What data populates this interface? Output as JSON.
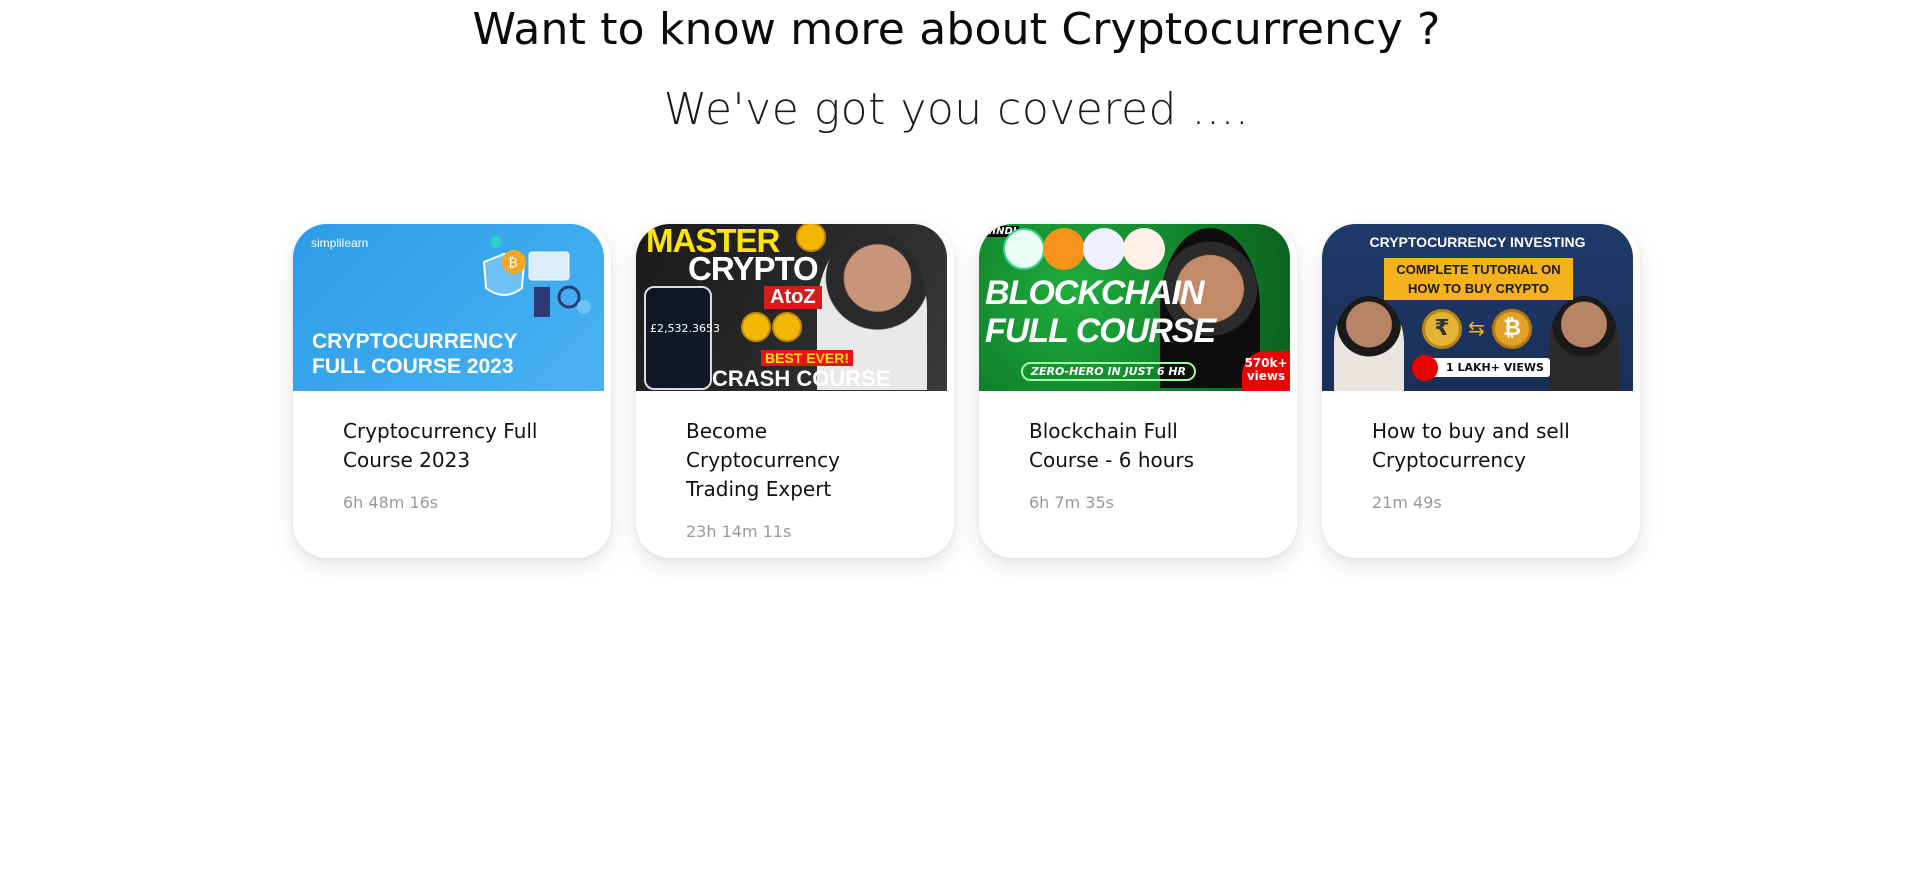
{
  "header": {
    "title": "Want to know more about Cryptocurrency ?",
    "subtitle": "We've got you covered ...."
  },
  "courses": [
    {
      "title": "Cryptocurrency Full Course 2023",
      "duration": "6h 48m 16s",
      "thumbnail": {
        "brand": "simplilearn",
        "headline_line1": "CRYPTOCURRENCY",
        "headline_line2": "FULL COURSE 2023",
        "accent": "#3aa8ee"
      }
    },
    {
      "title": "Become Cryptocurrency Trading Expert",
      "duration": "23h 14m 11s",
      "thumbnail": {
        "line1": "MASTER",
        "line2": "CRYPTO",
        "badge": "AtoZ",
        "balance": "£2,532.3653",
        "ribbon": "BEST EVER!",
        "footer": "CRASH COURSE",
        "accent": "#ffe500"
      }
    },
    {
      "title": "Blockchain Full Course - 6 hours",
      "duration": "6h 7m 35s",
      "thumbnail": {
        "tag": "HINDI",
        "line1": "BLOCKCHAIN",
        "line2": "FULL COURSE",
        "pill": "ZERO-HERO IN JUST 6 HR",
        "views_line1": "570k+",
        "views_line2": "views",
        "accent": "#1fae3c"
      }
    },
    {
      "title": "How to buy and sell Cryptocurrency",
      "duration": "21m 49s",
      "thumbnail": {
        "top": "CRYPTOCURRENCY INVESTING",
        "box_line1": "COMPLETE TUTORIAL ON",
        "box_line2": "HOW TO BUY CRYPTO",
        "views": "1 LAKH+ VIEWS",
        "rupee": "₹",
        "btc": "₿",
        "accent": "#f5b21c"
      }
    }
  ]
}
